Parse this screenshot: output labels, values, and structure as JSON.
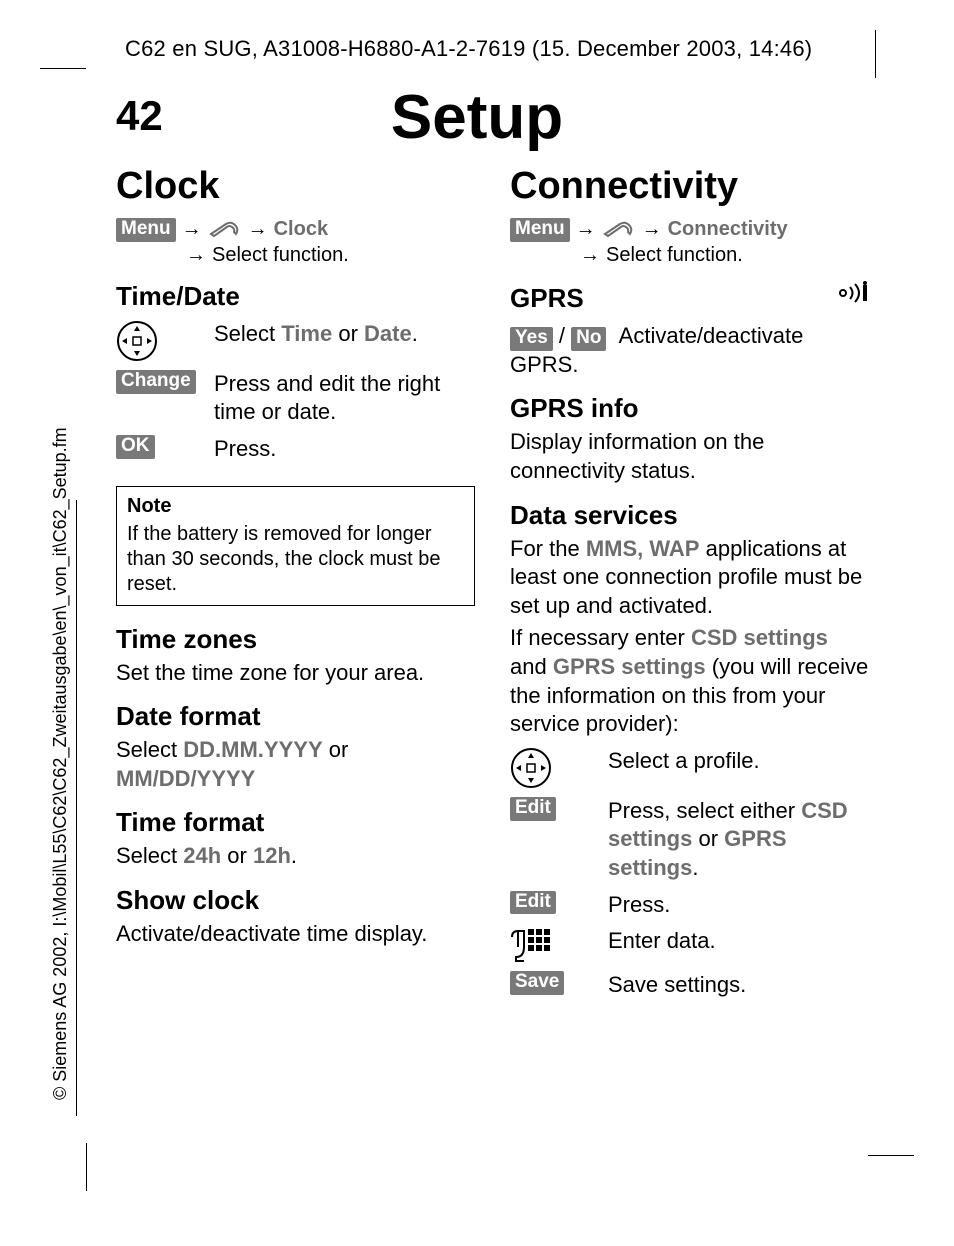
{
  "header_info": "C62 en SUG, A31008-H6880-A1-2-7619 (15. December 2003, 14:46)",
  "page_number": "42",
  "page_title": "Setup",
  "copyright_side": "© Siemens AG 2002, I:\\Mobil\\L55\\C62\\C62_Zweitausgabe\\en\\_von_it\\C62_Setup.fm",
  "softkeys": {
    "menu": "Menu",
    "change": "Change",
    "ok": "OK",
    "yes": "Yes",
    "no": "No",
    "edit": "Edit",
    "save": "Save"
  },
  "icon_names": {
    "arrow_right": "→",
    "wrench": "wrench",
    "navkey": "nav-key",
    "keypad": "keypad",
    "gprs_signal": "gprs-signal"
  },
  "left": {
    "h2": "Clock",
    "crumb_end": "Clock",
    "crumb_select": "Select function.",
    "time_date_h": "Time/Date",
    "td_row1_a": "Select ",
    "td_row1_b": "Time",
    "td_row1_c": " or ",
    "td_row1_d": "Date",
    "td_row1_e": ".",
    "td_row2": "Press and edit the right time or date.",
    "td_row3": "Press.",
    "note_h": "Note",
    "note_body": "If the battery is removed for longer than 30 seconds, the clock must be reset.",
    "timezones_h": "Time zones",
    "timezones_p": "Set the time zone for your area.",
    "dateformat_h": "Date format",
    "dateformat_a": "Select ",
    "dateformat_b": "DD.MM.YYYY",
    "dateformat_c": " or ",
    "dateformat_d": "MM/DD/YYYY",
    "timeformat_h": "Time format",
    "timeformat_a": "Select ",
    "timeformat_b": "24h",
    "timeformat_c": " or ",
    "timeformat_d": "12h",
    "timeformat_e": ".",
    "showclock_h": "Show clock",
    "showclock_p": "Activate/deactivate time display."
  },
  "right": {
    "h2": "Connectivity",
    "crumb_end": "Connectivity",
    "crumb_select": "Select function.",
    "gprs_h": "GPRS",
    "gprs_slash": " / ",
    "gprs_desc": "Activate/deactivate GPRS.",
    "gprsinfo_h": "GPRS info",
    "gprsinfo_p": "Display information on the connectivity status.",
    "dataserv_h": "Data services",
    "ds_p1_a": "For the ",
    "ds_p1_b": "MMS, WAP",
    "ds_p1_c": " applications at least one connection profile must be set up and activated.",
    "ds_p2_a": "If necessary enter ",
    "ds_p2_b": "CSD settings",
    "ds_p2_c": " and ",
    "ds_p2_d": "GPRS settings",
    "ds_p2_e": " (you will receive the information on this from your service provider):",
    "ds_row1": "Select a profile.",
    "ds_row2_a": "Press, select either ",
    "ds_row2_b": "CSD settings",
    "ds_row2_c": " or ",
    "ds_row2_d": "GPRS settings",
    "ds_row2_e": ".",
    "ds_row3": "Press.",
    "ds_row4": "Enter data.",
    "ds_row5": "Save settings."
  }
}
